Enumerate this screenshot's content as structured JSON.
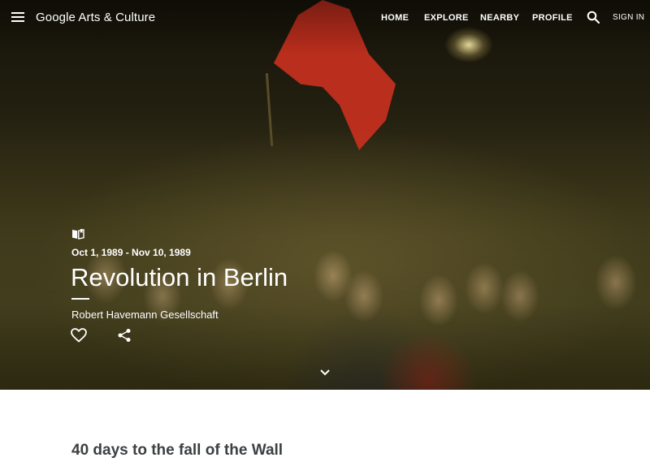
{
  "header": {
    "brand": "Google Arts & Culture",
    "nav": [
      {
        "label": "HOME"
      },
      {
        "label": "EXPLORE"
      },
      {
        "label": "NEARBY"
      },
      {
        "label": "PROFILE"
      }
    ],
    "sign_in_label": "SIGN IN"
  },
  "hero": {
    "date_range": "Oct 1, 1989 - Nov 10, 1989",
    "title": "Revolution in Berlin",
    "owner": "Robert Havemann Gesellschaft"
  },
  "content": {
    "subtitle": "40 days to the fall of the Wall"
  },
  "icons": {
    "menu": "menu-icon",
    "search": "search-icon",
    "story": "book-icon",
    "favorite": "heart-icon",
    "share": "share-icon",
    "scroll": "chevron-down-icon"
  },
  "colors": {
    "flag": "#c8301e",
    "text_on_hero": "#ffffff",
    "body_text": "#3c4043"
  }
}
